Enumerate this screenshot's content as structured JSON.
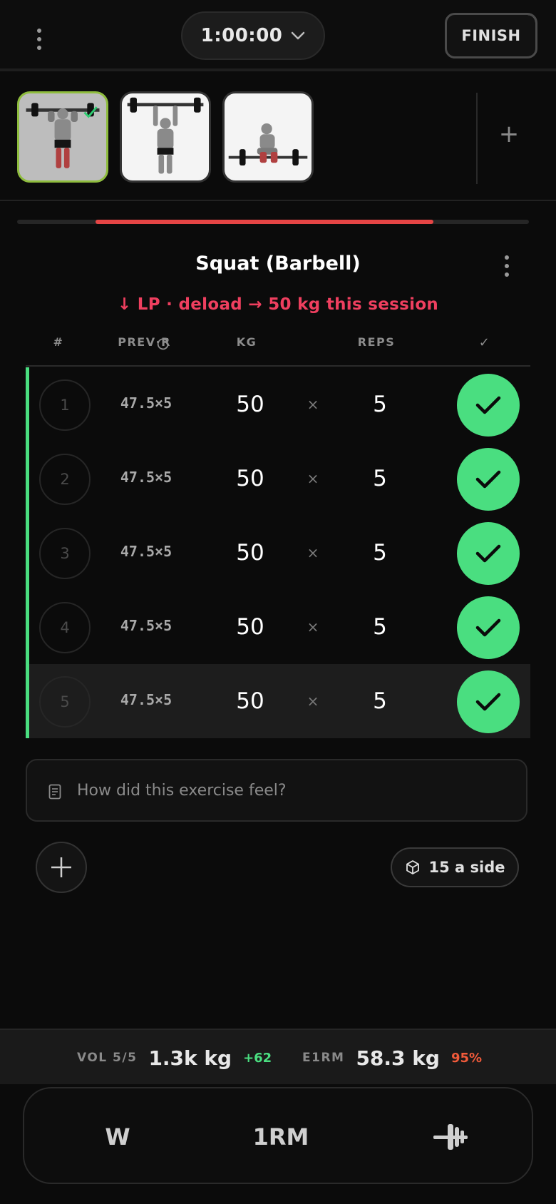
{
  "header": {
    "timer": "1:00:00",
    "finish_label": "FINISH"
  },
  "exercise_strip": {
    "thumbnails": [
      {
        "name": "Overhead Press (Barbell)",
        "active": true,
        "completed": true
      },
      {
        "name": "Overhead Press (Barbell)",
        "active": false,
        "completed": false
      },
      {
        "name": "Squat (Barbell)",
        "active": false,
        "completed": false
      }
    ],
    "add_label": "+",
    "progress": 0.66
  },
  "exercise": {
    "title": "Squat (Barbell)",
    "note": "↓ LP · deload → 50 kg this session"
  },
  "table": {
    "headers": {
      "set": "#",
      "prev": "PREV·R",
      "kg": "KG",
      "reps": "REPS",
      "done": "✓"
    },
    "rows": [
      {
        "set": "1",
        "prev": "47.5×5",
        "kg": "50",
        "times": "×",
        "reps": "5",
        "done": true
      },
      {
        "set": "2",
        "prev": "47.5×5",
        "kg": "50",
        "times": "×",
        "reps": "5",
        "done": true
      },
      {
        "set": "3",
        "prev": "47.5×5",
        "kg": "50",
        "times": "×",
        "reps": "5",
        "done": true
      },
      {
        "set": "4",
        "prev": "47.5×5",
        "kg": "50",
        "times": "×",
        "reps": "5",
        "done": true
      },
      {
        "set": "5",
        "prev": "47.5×5",
        "kg": "50",
        "times": "×",
        "reps": "5",
        "done": true
      }
    ]
  },
  "notes": {
    "placeholder": "How did this exercise feel?"
  },
  "plates": {
    "label": "15 a side"
  },
  "stats": {
    "vol_label": "VOL 5/5",
    "vol_value": "1.3k kg",
    "vol_delta": "+62",
    "e1rm_label": "E1RM",
    "e1rm_value": "58.3 kg",
    "e1rm_pct": "95%"
  },
  "bottom_nav": {
    "warmup": "W",
    "one_rm": "1RM",
    "plates_icon": "barbell-plates-icon"
  },
  "colors": {
    "accent_green": "#4ade80",
    "accent_red": "#e64545",
    "note_red": "#ef3f5f",
    "delta_green": "#4ade80",
    "pct_orange": "#f05a3a",
    "active_thumb_border": "#8fbd3e"
  }
}
